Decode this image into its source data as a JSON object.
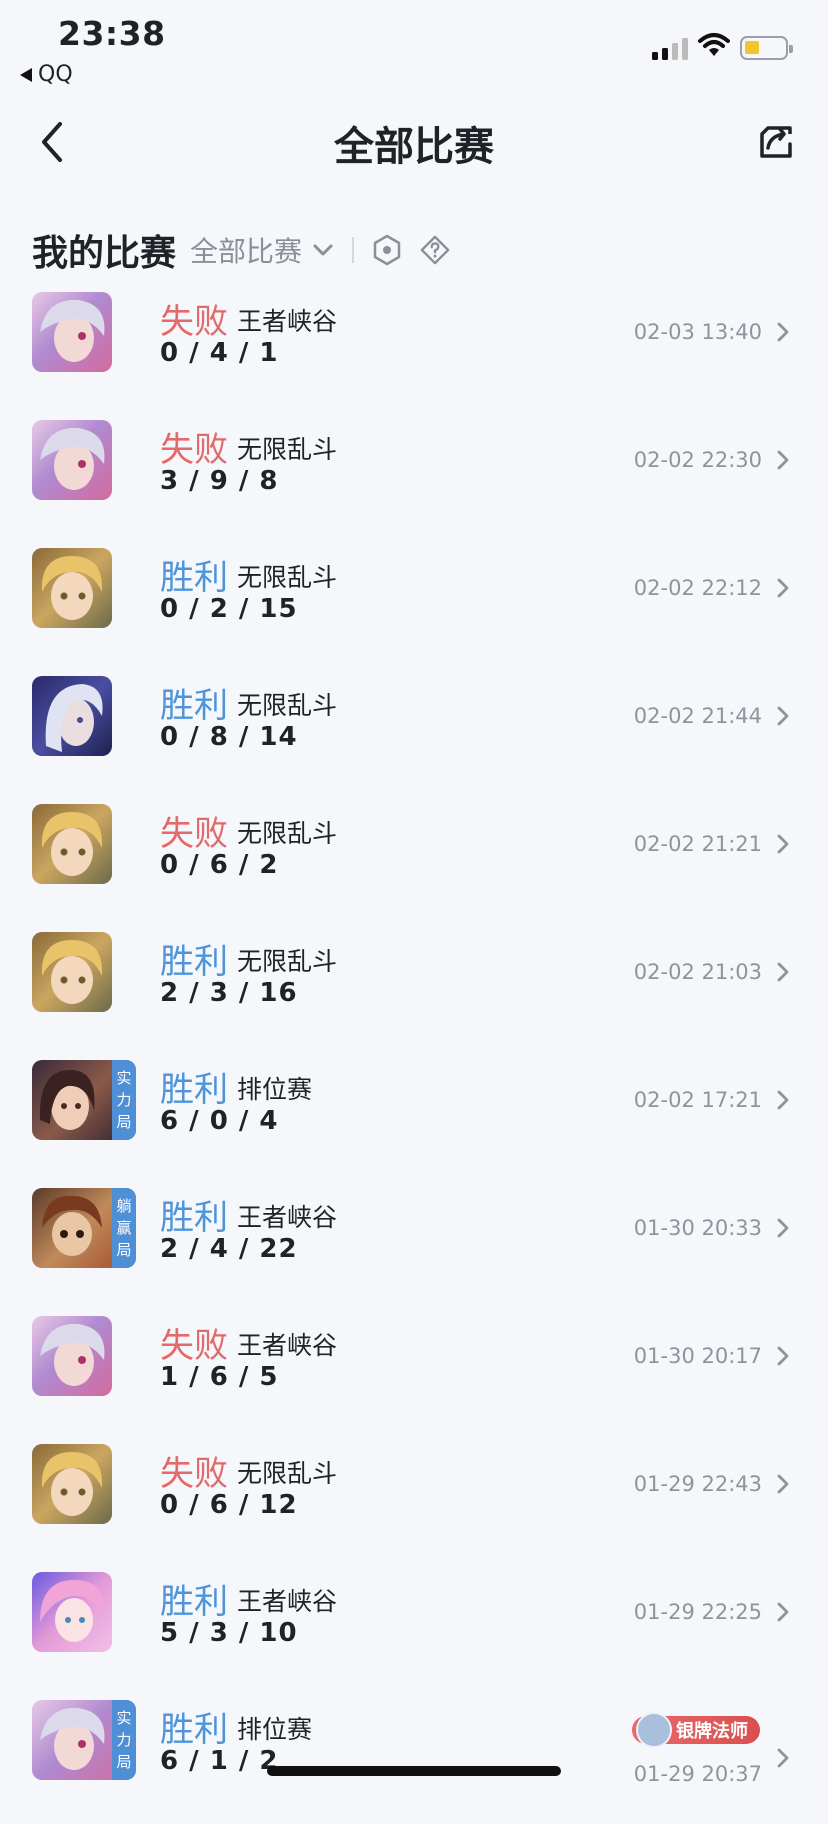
{
  "status": {
    "time": "23:38",
    "back_app": "QQ"
  },
  "header": {
    "title": "全部比赛"
  },
  "section": {
    "title": "我的比赛",
    "filter": "全部比赛"
  },
  "colors": {
    "loss": "#e26a6a",
    "win": "#4d94d8",
    "accent_tag": "#4f8fd6"
  },
  "matches": [
    {
      "result": "失败",
      "type": "loss",
      "mode": "王者峡谷",
      "kda": "0 / 4 / 1",
      "time": "02-03 13:40",
      "tag": ""
    },
    {
      "result": "失败",
      "type": "loss",
      "mode": "无限乱斗",
      "kda": "3 / 9 / 8",
      "time": "02-02 22:30",
      "tag": ""
    },
    {
      "result": "胜利",
      "type": "win",
      "mode": "无限乱斗",
      "kda": "0 / 2 / 15",
      "time": "02-02 22:12",
      "tag": ""
    },
    {
      "result": "胜利",
      "type": "win",
      "mode": "无限乱斗",
      "kda": "0 / 8 / 14",
      "time": "02-02 21:44",
      "tag": ""
    },
    {
      "result": "失败",
      "type": "loss",
      "mode": "无限乱斗",
      "kda": "0 / 6 / 2",
      "time": "02-02 21:21",
      "tag": ""
    },
    {
      "result": "胜利",
      "type": "win",
      "mode": "无限乱斗",
      "kda": "2 / 3 / 16",
      "time": "02-02 21:03",
      "tag": ""
    },
    {
      "result": "胜利",
      "type": "win",
      "mode": "排位赛",
      "kda": "6 / 0 / 4",
      "time": "02-02 17:21",
      "tag": "实力局"
    },
    {
      "result": "胜利",
      "type": "win",
      "mode": "王者峡谷",
      "kda": "2 / 4 / 22",
      "time": "01-30 20:33",
      "tag": "躺赢局"
    },
    {
      "result": "失败",
      "type": "loss",
      "mode": "王者峡谷",
      "kda": "1 / 6 / 5",
      "time": "01-30 20:17",
      "tag": ""
    },
    {
      "result": "失败",
      "type": "loss",
      "mode": "无限乱斗",
      "kda": "0 / 6 / 12",
      "time": "01-29 22:43",
      "tag": ""
    },
    {
      "result": "胜利",
      "type": "win",
      "mode": "王者峡谷",
      "kda": "5 / 3 / 10",
      "time": "01-29 22:25",
      "tag": ""
    },
    {
      "result": "胜利",
      "type": "win",
      "mode": "排位赛",
      "kda": "6 / 1 / 2",
      "time": "01-29 20:37",
      "tag": "实力局",
      "badge": "银牌法师"
    }
  ]
}
